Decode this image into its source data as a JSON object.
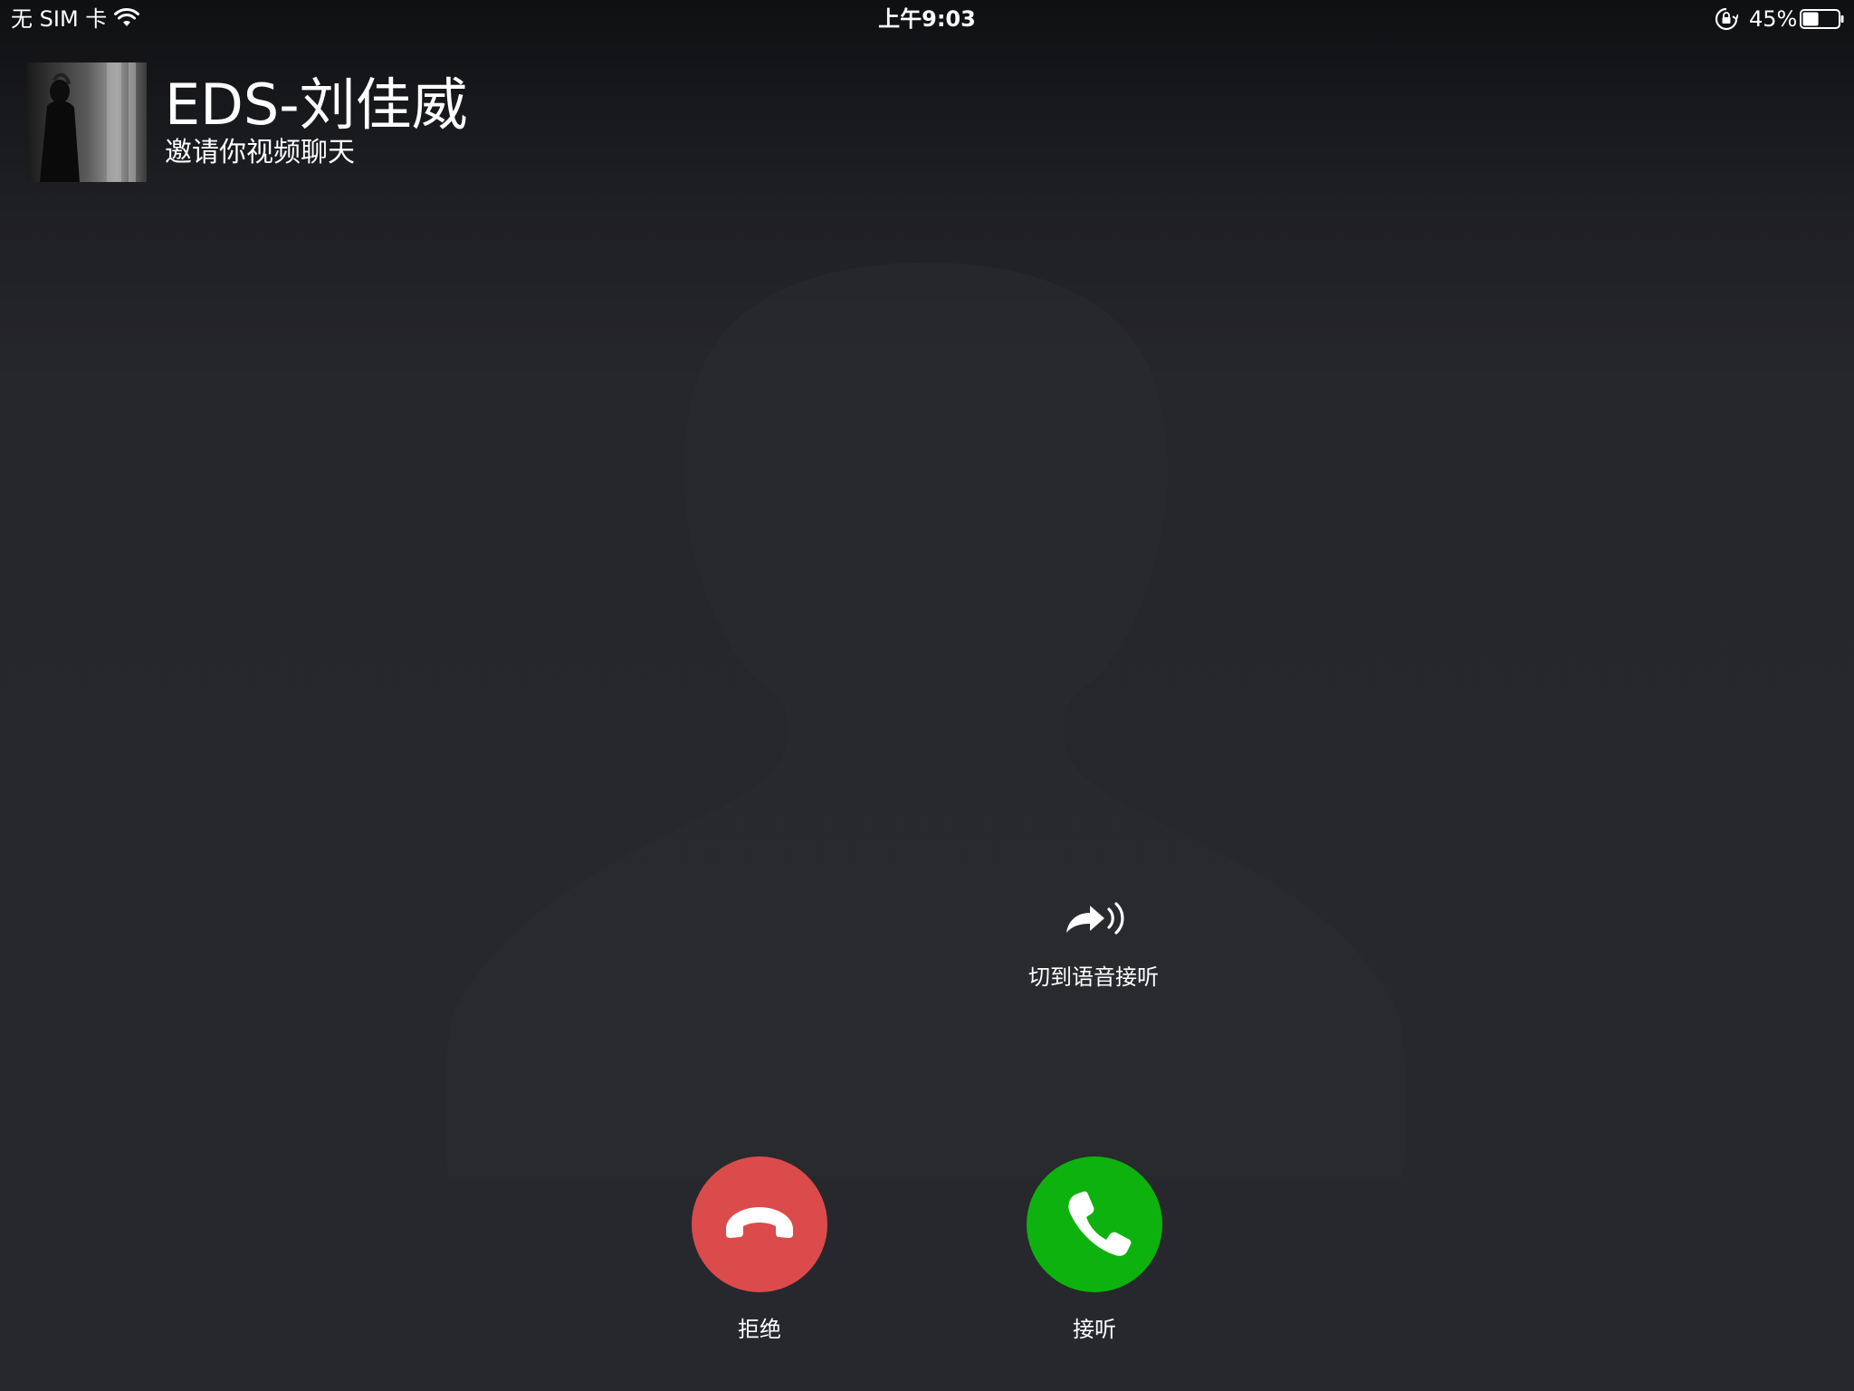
{
  "status_bar": {
    "carrier": "无 SIM 卡",
    "time": "上午9:03",
    "battery_percent": "45%",
    "battery_level": 0.45
  },
  "caller": {
    "name": "EDS-刘佳威",
    "subtitle": "邀请你视频聊天"
  },
  "actions": {
    "switch_to_voice": "切到语音接听",
    "decline": "拒绝",
    "accept": "接听"
  },
  "colors": {
    "decline": "#dc4b4b",
    "accept": "#0eb20e",
    "background": "#26272b"
  },
  "icons": {
    "status": [
      "wifi-icon",
      "rotation-lock-icon",
      "battery-icon"
    ],
    "switch_to_voice": "forward-speaker-icon",
    "decline": "hang-up-phone-icon",
    "accept": "phone-icon"
  }
}
